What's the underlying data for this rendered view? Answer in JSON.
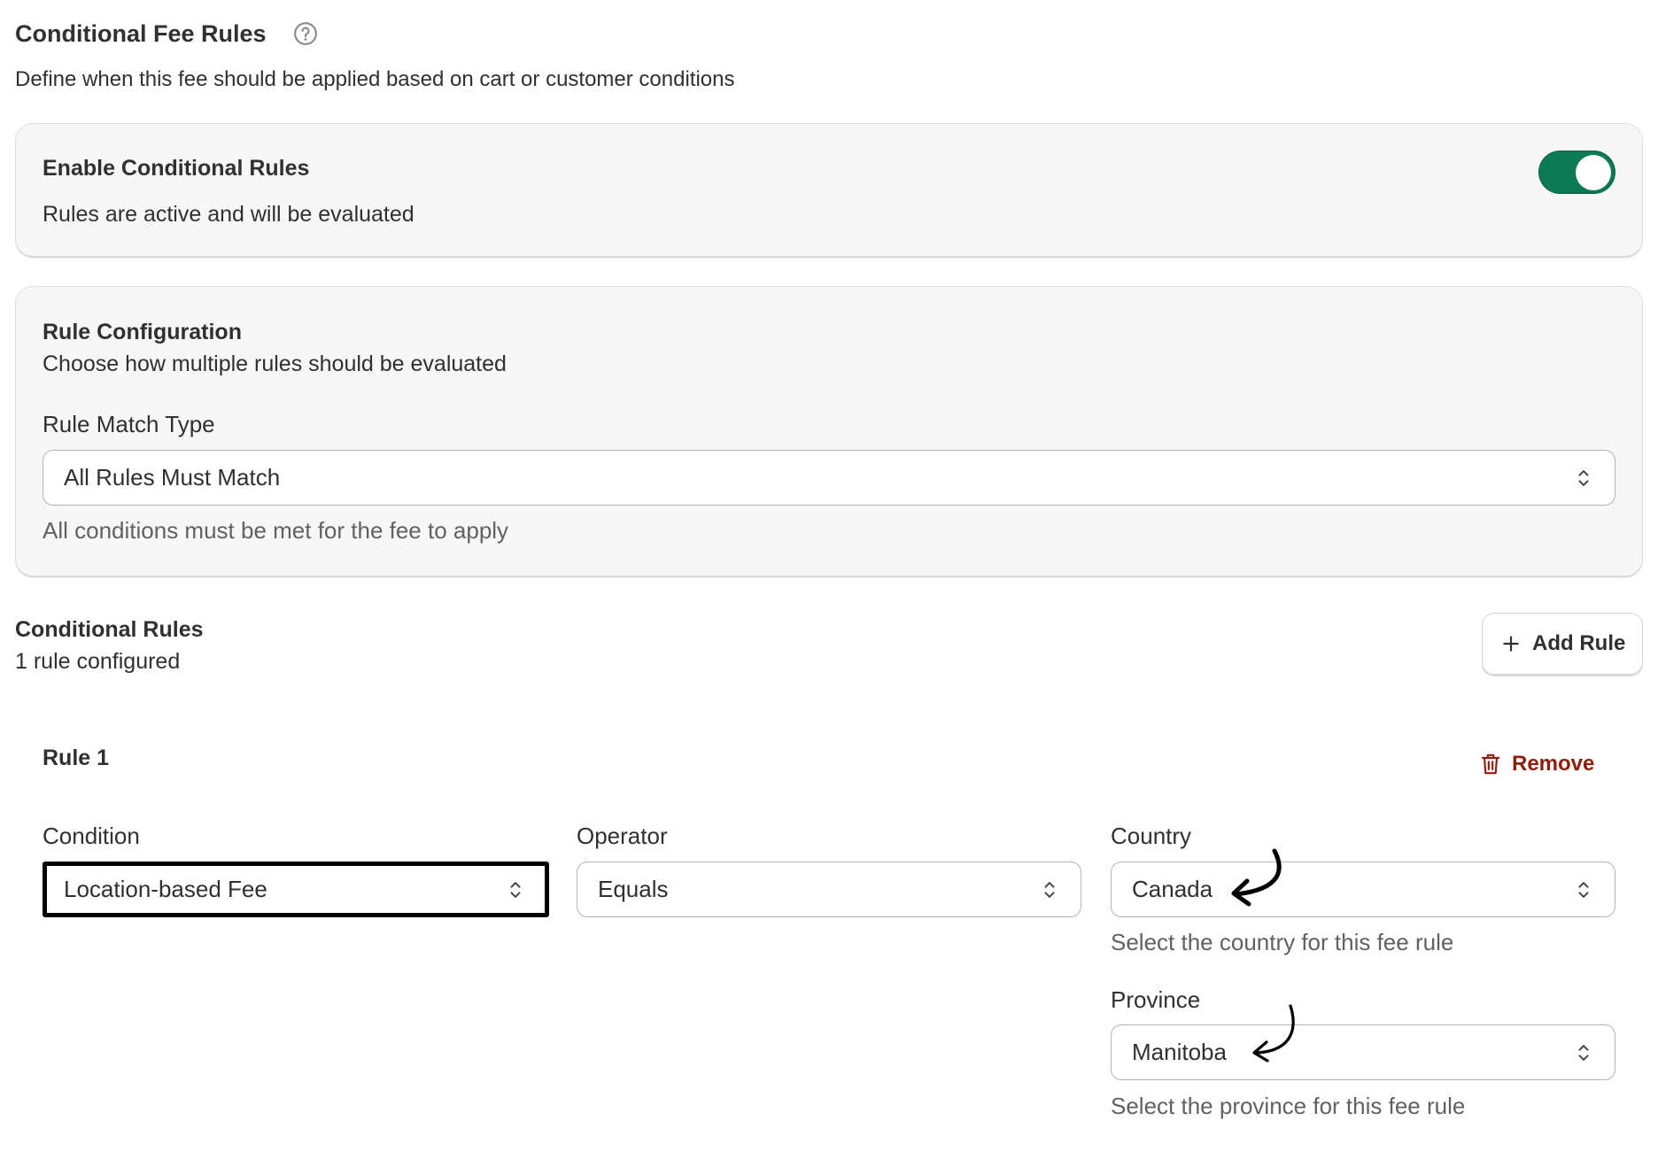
{
  "header": {
    "title": "Conditional Fee Rules",
    "description": "Define when this fee should be applied based on cart or customer conditions"
  },
  "enable_card": {
    "title": "Enable Conditional Rules",
    "status": "Rules are active and will be evaluated",
    "toggle_enabled": true
  },
  "rule_config": {
    "title": "Rule Configuration",
    "description": "Choose how multiple rules should be evaluated",
    "match_type_label": "Rule Match Type",
    "match_type_value": "All Rules Must Match",
    "match_type_help": "All conditions must be met for the fee to apply"
  },
  "rules_section": {
    "title": "Conditional Rules",
    "count": "1 rule configured",
    "add_button": "Add Rule"
  },
  "rules": [
    {
      "title": "Rule 1",
      "remove_label": "Remove",
      "condition": {
        "label": "Condition",
        "value": "Location-based Fee"
      },
      "operator": {
        "label": "Operator",
        "value": "Equals"
      },
      "country": {
        "label": "Country",
        "value": "Canada",
        "help": "Select the country for this fee rule"
      },
      "province": {
        "label": "Province",
        "value": "Manitoba",
        "help": "Select the province for this fee rule"
      }
    }
  ],
  "icons": {
    "help": "question-circle-icon",
    "add": "plus-icon",
    "remove": "trash-icon",
    "select": "chevron-up-down-icon",
    "annotation": "hand-drawn-arrow-icon"
  },
  "colors": {
    "text": "#303030",
    "muted_text": "#616161",
    "toggle_on": "#0b7a55",
    "danger": "#8e1f0b",
    "card_background": "#f7f7f7",
    "focus_outline": "#000000"
  }
}
